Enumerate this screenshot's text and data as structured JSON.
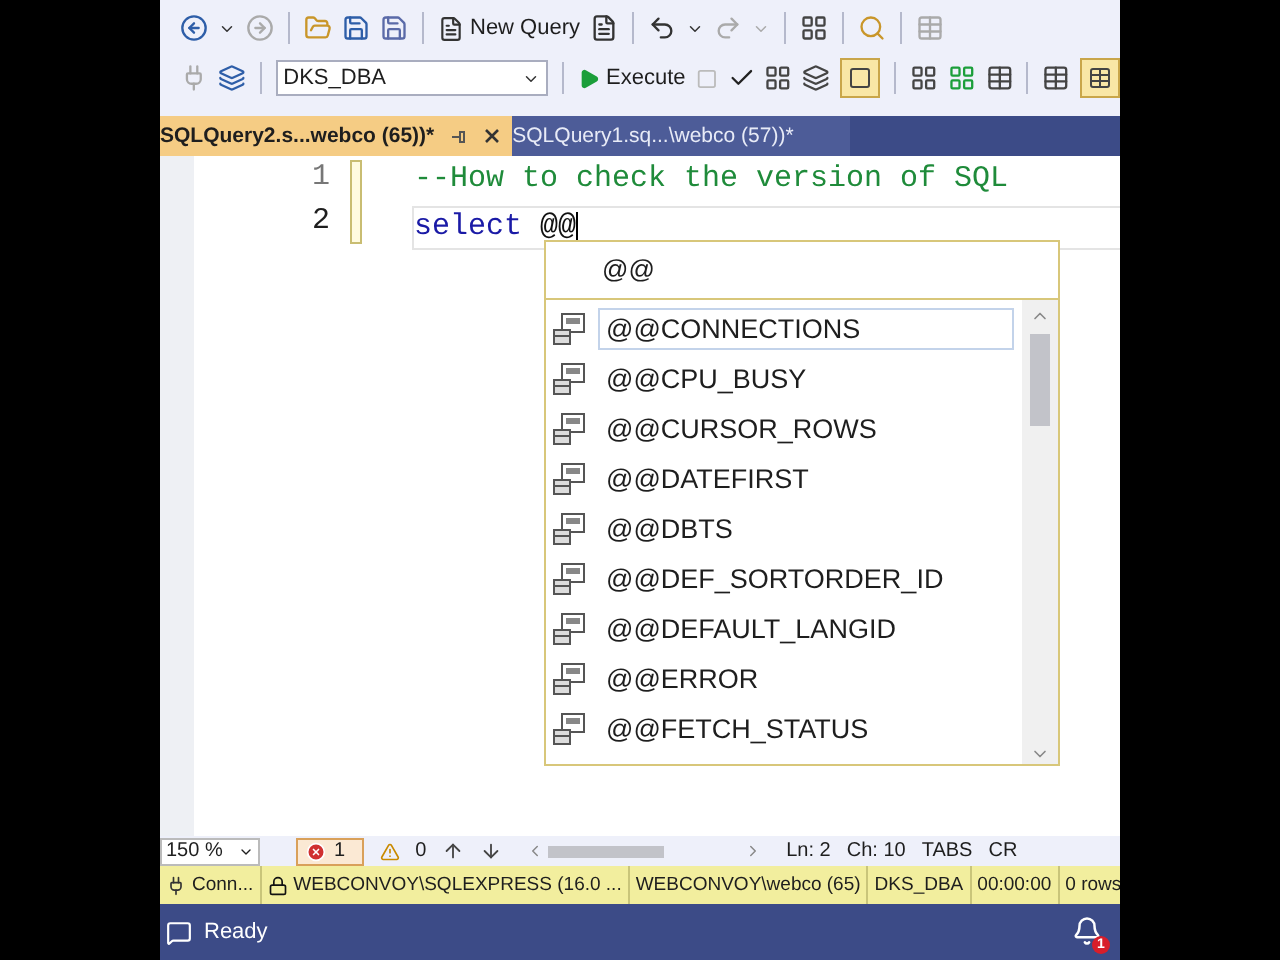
{
  "toolbar": {
    "new_query": "New Query",
    "database": "DKS_DBA",
    "execute": "Execute"
  },
  "tabs": [
    {
      "label": "SQLQuery2.s...webco (65))*",
      "selected": true
    },
    {
      "label": "SQLQuery1.sq...\\webco (57))*",
      "selected": false
    }
  ],
  "editor": {
    "lines": [
      {
        "number": "1",
        "current": false,
        "tokens": [
          {
            "text": "--How to check the version of SQL",
            "kind": "comment"
          }
        ]
      },
      {
        "number": "2",
        "current": true,
        "tokens": [
          {
            "text": "select",
            "kind": "keyword"
          },
          {
            "text": " @@",
            "kind": "plain"
          }
        ]
      }
    ]
  },
  "completion": {
    "typed": "@@",
    "items": [
      {
        "label": "@@CONNECTIONS",
        "selected": true
      },
      {
        "label": "@@CPU_BUSY",
        "selected": false
      },
      {
        "label": "@@CURSOR_ROWS",
        "selected": false
      },
      {
        "label": "@@DATEFIRST",
        "selected": false
      },
      {
        "label": "@@DBTS",
        "selected": false
      },
      {
        "label": "@@DEF_SORTORDER_ID",
        "selected": false
      },
      {
        "label": "@@DEFAULT_LANGID",
        "selected": false
      },
      {
        "label": "@@ERROR",
        "selected": false
      },
      {
        "label": "@@FETCH_STATUS",
        "selected": false
      }
    ]
  },
  "bottom_bar": {
    "zoom": "150 %",
    "errors": "1",
    "warnings": "0",
    "line": "Ln: 2",
    "column": "Ch: 10",
    "indent": "TABS",
    "eol": "CR"
  },
  "connection_bar": {
    "connection": "Conn...",
    "server": "WEBCONVOY\\SQLEXPRESS (16.0 ...",
    "user": "WEBCONVOY\\webco (65)",
    "database": "DKS_DBA",
    "time": "00:00:00",
    "rows": "0 rows"
  },
  "status_bar": {
    "text": "Ready",
    "notifications": "1"
  }
}
